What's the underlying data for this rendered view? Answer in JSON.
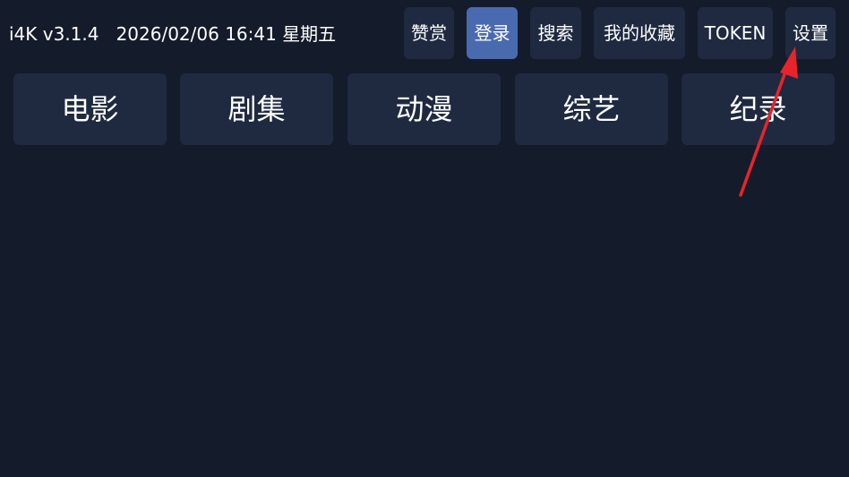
{
  "header": {
    "app_version": "i4K v3.1.4",
    "datetime": "2026/02/06 16:41 星期五"
  },
  "toolbar": {
    "donate_label": "赞赏",
    "login_label": "登录",
    "search_label": "搜索",
    "favorites_label": "我的收藏",
    "token_label": "TOKEN",
    "settings_label": "设置"
  },
  "categories": [
    {
      "label": "电影"
    },
    {
      "label": "剧集"
    },
    {
      "label": "动漫"
    },
    {
      "label": "综艺"
    },
    {
      "label": "纪录"
    }
  ],
  "colors": {
    "background": "#141b2b",
    "button": "#1f2a41",
    "active_button": "#4a6ab0",
    "annotation_arrow": "#e8242a"
  }
}
